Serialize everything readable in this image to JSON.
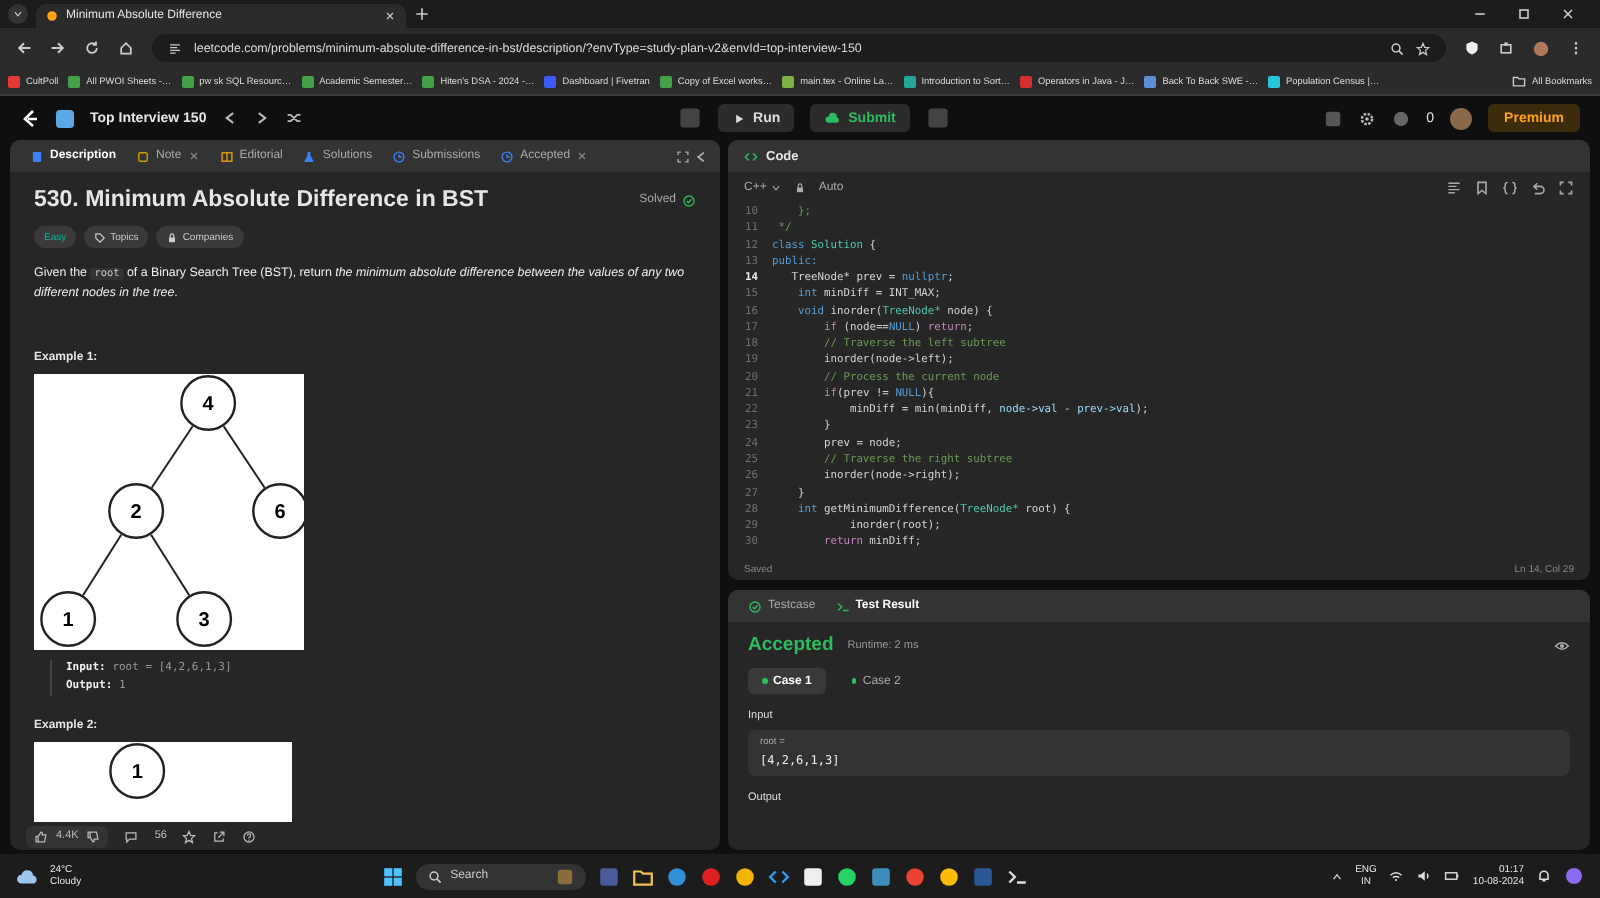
{
  "browser": {
    "tab_title": "Minimum Absolute Difference",
    "url": "leetcode.com/problems/minimum-absolute-difference-in-bst/description/?envType=study-plan-v2&envId=top-interview-150",
    "bookmarks": [
      {
        "label": "CultPoll",
        "color": "#e53935"
      },
      {
        "label": "All PWOI Sheets -…",
        "color": "#43a047"
      },
      {
        "label": "pw sk SQL Resourc…",
        "color": "#43a047"
      },
      {
        "label": "Academic Semester…",
        "color": "#43a047"
      },
      {
        "label": "Hiten's DSA - 2024 -…",
        "color": "#43a047"
      },
      {
        "label": "Dashboard | Fivetran",
        "color": "#3d5afe"
      },
      {
        "label": "Copy of Excel works…",
        "color": "#43a047"
      },
      {
        "label": "main.tex - Online La…",
        "color": "#7cb342"
      },
      {
        "label": "Introduction to Sort…",
        "color": "#26a69a"
      },
      {
        "label": "Operators in Java - J…",
        "color": "#d32f2f"
      },
      {
        "label": "Back To Back SWE -…",
        "color": "#5c8fd6"
      },
      {
        "label": "Population Census |…",
        "color": "#26c6da"
      }
    ],
    "all_bookmarks": "All Bookmarks"
  },
  "header": {
    "study_plan": "Top Interview 150",
    "run": "Run",
    "submit": "Submit",
    "points": "0",
    "premium": "Premium"
  },
  "left_tabs": [
    {
      "label": "Description",
      "selected": true,
      "closable": false
    },
    {
      "label": "Note",
      "selected": false,
      "closable": true
    },
    {
      "label": "Editorial",
      "selected": false,
      "closable": false
    },
    {
      "label": "Solutions",
      "selected": false,
      "closable": false
    },
    {
      "label": "Submissions",
      "selected": false,
      "closable": false
    },
    {
      "label": "Accepted",
      "selected": false,
      "closable": true
    }
  ],
  "problem": {
    "title": "530. Minimum Absolute Difference in BST",
    "status": "Solved",
    "tags": [
      {
        "label": "Easy",
        "kind": "difficulty"
      },
      {
        "label": "Topics",
        "kind": "topics"
      },
      {
        "label": "Companies",
        "kind": "companies"
      }
    ],
    "description": [
      {
        "kind": "text",
        "text": "Given the "
      },
      {
        "kind": "code",
        "text": "root"
      },
      {
        "kind": "text",
        "text": " of a Binary Search Tree (BST), return *the minimum absolute difference between the values of any two different nodes in the tree*."
      }
    ],
    "examples": [
      {
        "heading": "Example 1:",
        "tree": {
          "value": "4",
          "children": [
            {
              "value": "2",
              "children": [
                {
                  "value": "1"
                },
                {
                  "value": "3"
                }
              ]
            },
            {
              "value": "6"
            }
          ]
        },
        "input_label": "Input:",
        "input": "root = [4,2,6,1,3]",
        "output_label": "Output:",
        "output": "1"
      },
      {
        "heading": "Example 2:",
        "tree": {
          "value": "1"
        }
      }
    ]
  },
  "footer": {
    "likes": "4.4K",
    "comments": "56"
  },
  "code": {
    "title": "Code",
    "language": "C++",
    "mode": "Auto",
    "status": "Saved",
    "cursor": "Ln 14, Col 29",
    "lines": [
      {
        "num": "10",
        "current": false,
        "tokens": [
          {
            "kind": "comment",
            "text": "    };"
          }
        ]
      },
      {
        "num": "11",
        "current": false,
        "tokens": [
          {
            "kind": "comment",
            "text": " */"
          }
        ]
      },
      {
        "num": "12",
        "current": false,
        "tokens": [
          {
            "kind": "keyword",
            "text": "class"
          },
          {
            "kind": "type",
            "text": " Solution"
          },
          {
            "kind": "plain",
            "text": " {"
          }
        ]
      },
      {
        "num": "13",
        "current": false,
        "tokens": [
          {
            "kind": "keyword",
            "text": "public:"
          }
        ]
      },
      {
        "num": "14",
        "current": true,
        "tokens": [
          {
            "kind": "plain",
            "text": "   TreeNode* prev = "
          },
          {
            "kind": "keyword",
            "text": "nullptr"
          },
          {
            "kind": "plain",
            "text": ";"
          }
        ]
      },
      {
        "num": "15",
        "current": false,
        "tokens": [
          {
            "kind": "keyword",
            "text": "    int"
          },
          {
            "kind": "plain",
            "text": " minDiff = INT_MAX;"
          }
        ]
      },
      {
        "num": "16",
        "current": false,
        "tokens": [
          {
            "kind": "keyword",
            "text": "    void"
          },
          {
            "kind": "plain",
            "text": " inorder("
          },
          {
            "kind": "type",
            "text": "TreeNode*"
          },
          {
            "kind": "plain",
            "text": " node) {"
          }
        ]
      },
      {
        "num": "17",
        "current": false,
        "tokens": [
          {
            "kind": "control",
            "text": "        if"
          },
          {
            "kind": "plain",
            "text": " (node=="
          },
          {
            "kind": "keyword",
            "text": "NULL"
          },
          {
            "kind": "plain",
            "text": ") "
          },
          {
            "kind": "control",
            "text": "return"
          },
          {
            "kind": "plain",
            "text": ";"
          }
        ]
      },
      {
        "num": "18",
        "current": false,
        "tokens": [
          {
            "kind": "comment",
            "text": "        // Traverse the left subtree"
          }
        ]
      },
      {
        "num": "19",
        "current": false,
        "tokens": [
          {
            "kind": "plain",
            "text": "        inorder(node->left);"
          }
        ]
      },
      {
        "num": "20",
        "current": false,
        "tokens": [
          {
            "kind": "comment",
            "text": "        // Process the current node"
          }
        ]
      },
      {
        "num": "21",
        "current": false,
        "tokens": [
          {
            "kind": "control",
            "text": "        if"
          },
          {
            "kind": "plain",
            "text": "(prev != "
          },
          {
            "kind": "keyword",
            "text": "NULL"
          },
          {
            "kind": "plain",
            "text": "){"
          }
        ]
      },
      {
        "num": "22",
        "current": false,
        "tokens": [
          {
            "kind": "plain",
            "text": "            minDiff = min(minDiff, "
          },
          {
            "kind": "member",
            "text": "node->val"
          },
          {
            "kind": "plain",
            "text": " - "
          },
          {
            "kind": "member",
            "text": "prev->val"
          },
          {
            "kind": "plain",
            "text": ");"
          }
        ]
      },
      {
        "num": "23",
        "current": false,
        "tokens": [
          {
            "kind": "plain",
            "text": "        }"
          }
        ]
      },
      {
        "num": "24",
        "current": false,
        "tokens": [
          {
            "kind": "plain",
            "text": "        prev = node;"
          }
        ]
      },
      {
        "num": "25",
        "current": false,
        "tokens": [
          {
            "kind": "comment",
            "text": "        // Traverse the right subtree"
          }
        ]
      },
      {
        "num": "26",
        "current": false,
        "tokens": [
          {
            "kind": "plain",
            "text": "        inorder(node->right);"
          }
        ]
      },
      {
        "num": "27",
        "current": false,
        "tokens": [
          {
            "kind": "plain",
            "text": "    }"
          }
        ]
      },
      {
        "num": "28",
        "current": false,
        "tokens": [
          {
            "kind": "keyword",
            "text": "    int"
          },
          {
            "kind": "plain",
            "text": " getMinimumDifference("
          },
          {
            "kind": "type",
            "text": "TreeNode*"
          },
          {
            "kind": "plain",
            "text": " root) {"
          }
        ]
      },
      {
        "num": "29",
        "current": false,
        "tokens": [
          {
            "kind": "plain",
            "text": "            inorder(root);"
          }
        ]
      },
      {
        "num": "30",
        "current": false,
        "tokens": [
          {
            "kind": "control",
            "text": "        return"
          },
          {
            "kind": "plain",
            "text": " minDiff;"
          }
        ]
      }
    ]
  },
  "result": {
    "tabs": [
      {
        "label": "Testcase",
        "selected": false
      },
      {
        "label": "Test Result",
        "selected": true
      }
    ],
    "verdict": "Accepted",
    "runtime": "Runtime: 2 ms",
    "cases": [
      {
        "label": "Case 1",
        "selected": true
      },
      {
        "label": "Case 2",
        "selected": false
      }
    ],
    "input_label": "Input",
    "param_name": "root =",
    "param_value": "[4,2,6,1,3]",
    "output_label": "Output"
  },
  "taskbar": {
    "temperature": "24°C",
    "weather": "Cloudy",
    "search": "Search",
    "language": "ENG",
    "region": "IN",
    "time": "01:17",
    "date": "10-08-2024"
  }
}
